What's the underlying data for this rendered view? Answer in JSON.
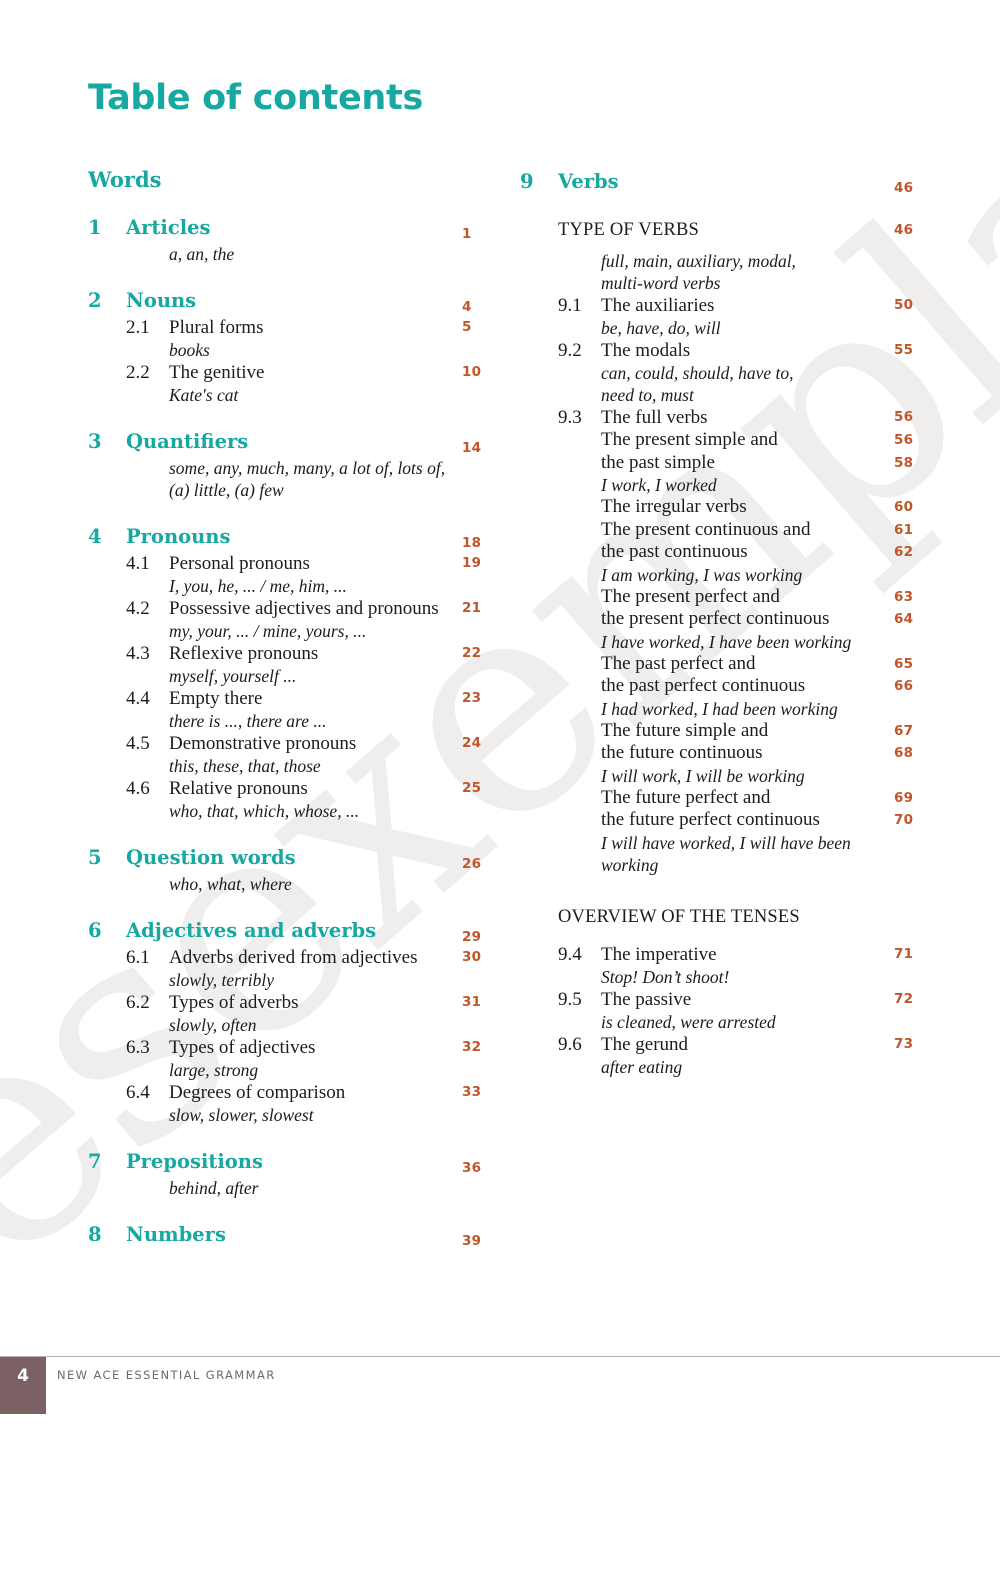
{
  "document": {
    "title": "Table of contents",
    "watermark": "Leesexemplaar"
  },
  "colors": {
    "teal": "#17a8a2",
    "orange": "#c0562a",
    "footer_badge": "#7c6063",
    "watermark": "#f0eeec"
  },
  "left_column": {
    "part_heading": "Words",
    "chapters": [
      {
        "num": "1",
        "title": "Articles",
        "page": "1",
        "example": "a, an, the",
        "subs": []
      },
      {
        "num": "2",
        "title": "Nouns",
        "page": "4",
        "subs": [
          {
            "num": "2.1",
            "title": "Plural forms",
            "page": "5",
            "example": "books"
          },
          {
            "num": "2.2",
            "title": "The genitive",
            "page": "10",
            "example": "Kate's cat"
          }
        ]
      },
      {
        "num": "3",
        "title": "Quantifiers",
        "page": "14",
        "example_lines": [
          "some, any, much, many, a lot of, lots of,",
          "(a) little, (a) few"
        ],
        "subs": []
      },
      {
        "num": "4",
        "title": "Pronouns",
        "page": "18",
        "subs": [
          {
            "num": "4.1",
            "title": "Personal pronouns",
            "page": "19",
            "example": "I, you, he, ... / me, him, ..."
          },
          {
            "num": "4.2",
            "title": "Possessive adjectives and pronouns",
            "page": "21",
            "example": "my, your, ... / mine, yours, ..."
          },
          {
            "num": "4.3",
            "title": "Reflexive pronouns",
            "page": "22",
            "example": "myself, yourself ..."
          },
          {
            "num": "4.4",
            "title": "Empty there",
            "page": "23",
            "example": "there is ..., there are ..."
          },
          {
            "num": "4.5",
            "title": "Demonstrative pronouns",
            "page": "24",
            "example": "this, these, that, those"
          },
          {
            "num": "4.6",
            "title": "Relative pronouns",
            "page": "25",
            "example": "who, that, which, whose, ..."
          }
        ]
      },
      {
        "num": "5",
        "title": "Question words",
        "page": "26",
        "example": "who, what, where",
        "subs": []
      },
      {
        "num": "6",
        "title": "Adjectives and adverbs",
        "page": "29",
        "subs": [
          {
            "num": "6.1",
            "title": "Adverbs derived from adjectives",
            "page": "30",
            "example": "slowly, terribly"
          },
          {
            "num": "6.2",
            "title": "Types of adverbs",
            "page": "31",
            "example": "slowly, often"
          },
          {
            "num": "6.3",
            "title": "Types of adjectives",
            "page": "32",
            "example": "large, strong"
          },
          {
            "num": "6.4",
            "title": "Degrees of comparison",
            "page": "33",
            "example": "slow, slower, slowest"
          }
        ]
      },
      {
        "num": "7",
        "title": "Prepositions",
        "page": "36",
        "example": "behind, after",
        "subs": []
      },
      {
        "num": "8",
        "title": "Numbers",
        "page": "39",
        "subs": []
      }
    ]
  },
  "right_column": {
    "chapter": {
      "num": "9",
      "title": "Verbs",
      "page": "46"
    },
    "section_type_of_verbs": {
      "header": "TYPE OF VERBS",
      "header_page": "46",
      "example_lines": [
        "full, main, auxiliary, modal,",
        "multi-word verbs"
      ],
      "subs": [
        {
          "num": "9.1",
          "title": "The auxiliaries",
          "page": "50",
          "example": "be, have, do, will"
        },
        {
          "num": "9.2",
          "title": "The modals",
          "page": "55",
          "example_lines": [
            "can, could, should, have to,",
            "need to, must"
          ]
        },
        {
          "num": "9.3",
          "title": "The full verbs",
          "page": "56",
          "entries": [
            {
              "lines": [
                {
                  "text": "The present simple and",
                  "page": "56"
                },
                {
                  "text": "the past simple",
                  "page": "58"
                }
              ],
              "example": "I work, I worked"
            },
            {
              "lines": [
                {
                  "text": "The irregular verbs",
                  "page": "60"
                }
              ]
            },
            {
              "lines": [
                {
                  "text": "The present continuous and",
                  "page": "61"
                },
                {
                  "text": "the past continuous",
                  "page": "62"
                }
              ],
              "example": "I am working, I was working"
            },
            {
              "lines": [
                {
                  "text": "The present perfect and",
                  "page": "63"
                },
                {
                  "text": "the present perfect continuous",
                  "page": "64"
                }
              ],
              "example": "I have worked, I have been working"
            },
            {
              "lines": [
                {
                  "text": "The past perfect and",
                  "page": "65"
                },
                {
                  "text": "the past perfect continuous",
                  "page": "66"
                }
              ],
              "example": "I had worked, I had been working"
            },
            {
              "lines": [
                {
                  "text": "The future simple and",
                  "page": "67"
                },
                {
                  "text": "the future continuous",
                  "page": "68"
                }
              ],
              "example": "I will work, I will be working"
            },
            {
              "lines": [
                {
                  "text": "The future perfect and",
                  "page": "69"
                },
                {
                  "text": "the future perfect continuous",
                  "page": "70"
                }
              ],
              "example_lines": [
                "I will have worked, I will have been",
                "working"
              ]
            }
          ]
        }
      ]
    },
    "section_overview": {
      "header": "OVERVIEW OF THE TENSES",
      "subs": [
        {
          "num": "9.4",
          "title": "The imperative",
          "page": "71",
          "example": "Stop! Don’t shoot!"
        },
        {
          "num": "9.5",
          "title": "The passive",
          "page": "72",
          "example": "is cleaned, were arrested"
        },
        {
          "num": "9.6",
          "title": "The gerund",
          "page": "73",
          "example": "after eating"
        }
      ]
    }
  },
  "footer": {
    "page_number": "4",
    "book_title": "NEW ACE ESSENTIAL GRAMMAR"
  }
}
